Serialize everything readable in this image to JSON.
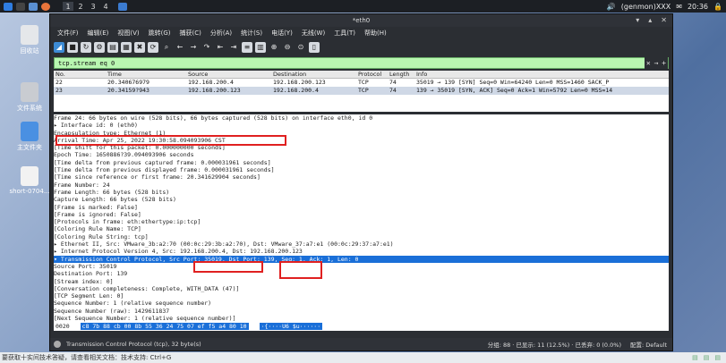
{
  "panel": {
    "workspaces": [
      "1",
      "2",
      "3",
      "4"
    ],
    "user": "(genmon)XXX",
    "time": "20:36"
  },
  "desktop_icons": [
    {
      "label": "回收站"
    },
    {
      "label": "文件系统"
    },
    {
      "label": "主文件夹"
    },
    {
      "label": "short-0704..."
    }
  ],
  "window": {
    "title": "*eth0",
    "menu": [
      "文件(F)",
      "编辑(E)",
      "视图(V)",
      "跳转(G)",
      "捕获(C)",
      "分析(A)",
      "统计(S)",
      "电话(Y)",
      "无线(W)",
      "工具(T)",
      "帮助(H)"
    ],
    "filter": "tcp.stream eq 0",
    "columns": {
      "no": "No.",
      "time": "Time",
      "source": "Source",
      "destination": "Destination",
      "protocol": "Protocol",
      "length": "Length",
      "info": "Info"
    },
    "packets": [
      {
        "no": "22",
        "time": "20.340676979",
        "source": "192.168.200.4",
        "destination": "192.168.200.123",
        "protocol": "TCP",
        "length": "74",
        "info": "35019 → 139 [SYN] Seq=0 Win=64240 Len=0 MSS=1460 SACK_P"
      },
      {
        "no": "23",
        "time": "20.34159?943",
        "source": "192.168.200.123",
        "destination": "192.168.200.4",
        "protocol": "TCP",
        "length": "74",
        "info": "139 → 35019 [SYN, ACK] Seq=0 Ack=1 Win=5792 Len=0 MSS=14"
      }
    ],
    "detail_lines": [
      "Frame 24: 66 bytes on wire (528 bits), 66 bytes captured (528 bits) on interface eth0, id 0",
      "  ▸ Interface id: 0 (eth0)",
      "    Encapsulation type: Ethernet (1)",
      "    Arrival Time: Apr 25, 2022 19:30:58.094093906 CST",
      "    [Time shift for this packet: 0.000000000 seconds]",
      "    Epoch Time: 1650886?39.094093906 seconds",
      "    [Time delta from previous captured frame: 0.000031961 seconds]",
      "    [Time delta from previous displayed frame: 0.000031961 seconds]",
      "    [Time since reference or first frame: 20.341629904 seconds]",
      "    Frame Number: 24",
      "    Frame Length: 66 bytes (528 bits)",
      "    Capture Length: 66 bytes (528 bits)",
      "    [Frame is marked: False]",
      "    [Frame is ignored: False]",
      "    [Protocols in frame: eth:ethertype:ip:tcp]",
      "    [Coloring Rule Name: TCP]",
      "    [Coloring Rule String: tcp]",
      "▸ Ethernet II, Src: VMware_3b:a2:70 (00:0c:29:3b:a2:70), Dst: VMware_37:a7:e1 (00:0c:29:37:a7:e1)",
      "▸ Internet Protocol Version 4, Src: 192.168.200.4, Dst: 192.168.200.123",
      "▾ Transmission Control Protocol, Src Port: 35019, Dst Port: 139, Seq: 1, Ack: 1, Len: 0",
      "    Source Port: 35019",
      "    Destination Port: 139",
      "    [Stream index: 0]",
      "    [Conversation completeness: Complete, WITH_DATA (47)]",
      "    [TCP Segment Len: 0]",
      "    Sequence Number: 1    (relative sequence number)",
      "    Sequence Number (raw): 1429611837",
      "    [Next Sequence Number: 1    (relative sequence number)]"
    ],
    "selected_detail_index": 19,
    "hex": {
      "offset": "0020",
      "bytes": "c8 7b 88 cb 00 8b 55 36  24 75 07 ef f5 a4 80 10",
      "ascii": "·{····U6 $u······"
    },
    "status": {
      "left": "Transmission Control Protocol (tcp), 32 byte(s)",
      "packets": "分组: 88 · 已显示: 11 (12.5%) · 已丢弃: 0 (0.0%)",
      "profile": "配置: Default"
    }
  },
  "bottom": {
    "text": "要获取十实间技术答疑，请查看相关文档：技术支持: Ctrl+G"
  },
  "colors": {
    "selected": "#1a6fd8",
    "filter_ok": "#b9f7b1",
    "annotation": "#e02020"
  }
}
